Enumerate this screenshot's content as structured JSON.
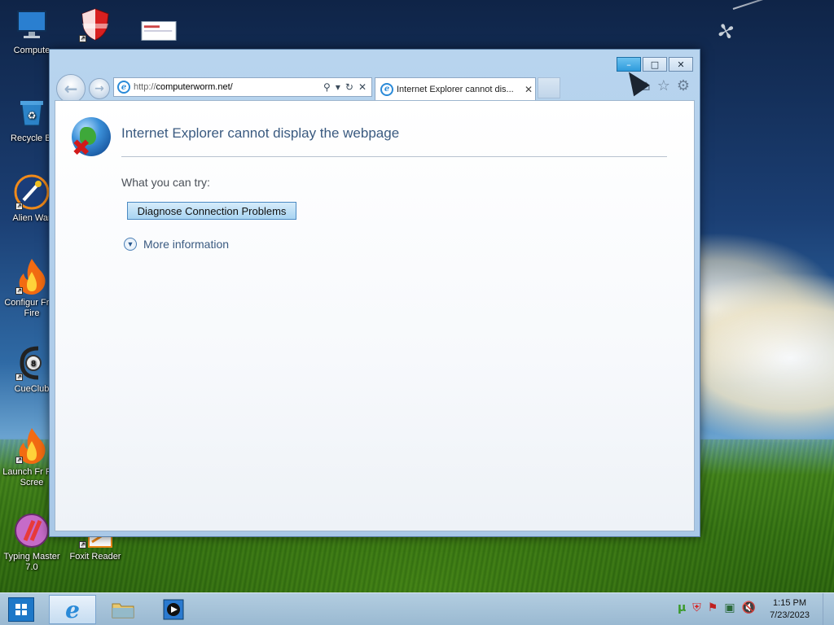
{
  "desktop": {
    "icons": [
      {
        "label": "Compute",
        "icon": "monitor-icon"
      },
      {
        "label": "Recycle Bi",
        "icon": "recycle-bin-icon"
      },
      {
        "label": "Alien War",
        "icon": "alien-war-icon"
      },
      {
        "label": "Configur Free Fire",
        "icon": "flame-icon"
      },
      {
        "label": "CueClub",
        "icon": "cueclub-icon"
      },
      {
        "label": "Launch Fr Fire Scree",
        "icon": "flame-icon"
      },
      {
        "label": "Typing Master 7.0",
        "icon": "typing-master-icon"
      },
      {
        "label": "Foxit Reader",
        "icon": "foxit-reader-icon"
      }
    ]
  },
  "browser": {
    "address_url": "http://computerworm.net/",
    "address_scheme": "http://",
    "address_host": "computerworm.net/",
    "tab_title": "Internet Explorer cannot dis...",
    "window_controls": {
      "minimize": "–",
      "maximize": "□",
      "close": "✕"
    }
  },
  "error_page": {
    "title": "Internet Explorer cannot display the webpage",
    "try_label": "What you can try:",
    "diagnose_button": "Diagnose Connection Problems",
    "more_info": "More information"
  },
  "taskbar": {
    "time": "1:15 PM",
    "date": "7/23/2023"
  },
  "colors": {
    "accent": "#2e9bdc",
    "title_text": "#3a5a80",
    "error_red": "#d21a1a"
  }
}
